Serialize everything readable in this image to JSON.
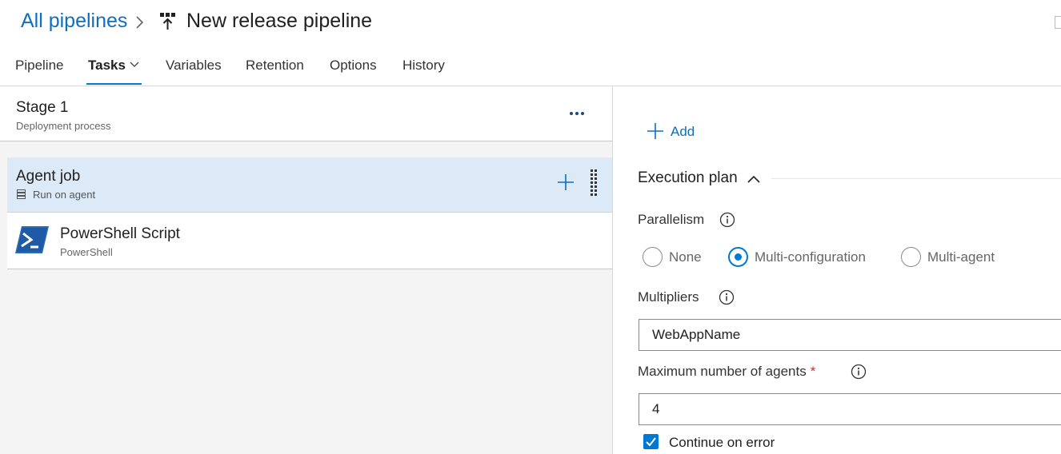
{
  "header": {
    "breadcrumb_link": "All pipelines",
    "title": "New release pipeline",
    "pipeline_icon": "release-pipeline-icon"
  },
  "tabs": [
    {
      "label": "Pipeline",
      "active": false
    },
    {
      "label": "Tasks",
      "active": true
    },
    {
      "label": "Variables",
      "active": false
    },
    {
      "label": "Retention",
      "active": false
    },
    {
      "label": "Options",
      "active": false
    },
    {
      "label": "History",
      "active": false
    }
  ],
  "stage": {
    "name": "Stage 1",
    "subtitle": "Deployment process"
  },
  "agent_job": {
    "name": "Agent job",
    "subtitle": "Run on agent",
    "icon": "server-icon"
  },
  "tasks_list": [
    {
      "name": "PowerShell Script",
      "subtitle": "PowerShell",
      "icon": "powershell-icon"
    }
  ],
  "details": {
    "add_label": "Add",
    "section_title": "Execution plan",
    "parallelism_label": "Parallelism",
    "parallelism_options": [
      "None",
      "Multi-configuration",
      "Multi-agent"
    ],
    "parallelism_selected": "Multi-configuration",
    "multipliers_label": "Multipliers",
    "multipliers_value": "WebAppName",
    "max_agents_label": "Maximum number of agents",
    "required_marker": "*",
    "max_agents_value": "4",
    "continue_on_error_label": "Continue on error",
    "continue_on_error_checked": true
  },
  "colors": {
    "accent": "#0078d4",
    "link": "#106ebe",
    "selected_row": "#dceaf8",
    "required": "#c4312f"
  }
}
